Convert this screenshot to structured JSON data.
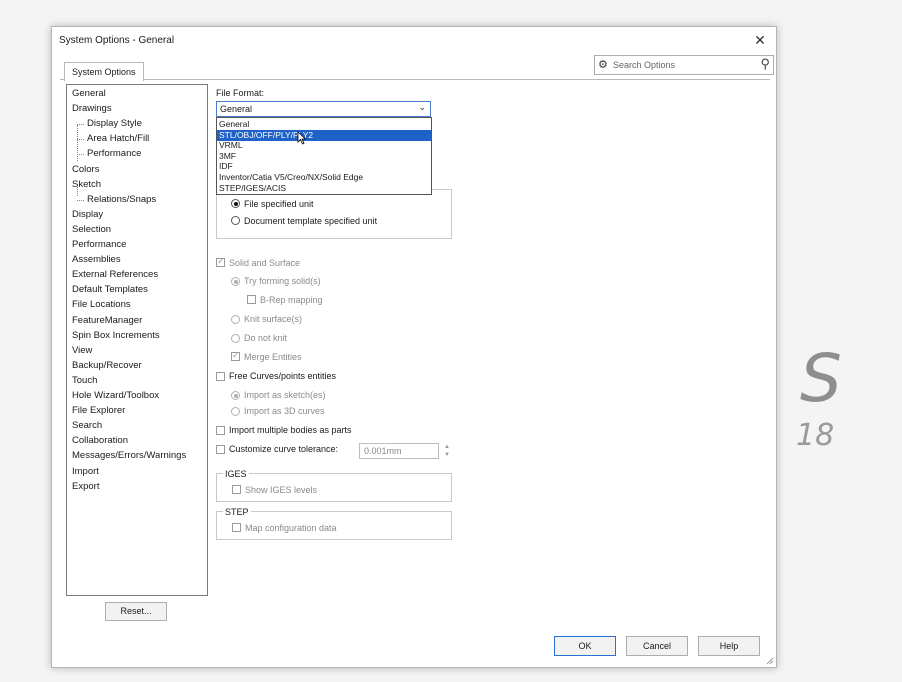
{
  "background": {
    "brand_letter": "S",
    "brand_year": "18"
  },
  "window": {
    "title": "System Options - General",
    "close_glyph": "✕"
  },
  "tab": {
    "label": "System Options"
  },
  "search": {
    "placeholder": "Search Options"
  },
  "tree": {
    "items": [
      {
        "label": "General",
        "indent": 0
      },
      {
        "label": "Drawings",
        "indent": 0
      },
      {
        "label": "Display Style",
        "indent": 1
      },
      {
        "label": "Area Hatch/Fill",
        "indent": 1
      },
      {
        "label": "Performance",
        "indent": 1
      },
      {
        "label": "Colors",
        "indent": 0
      },
      {
        "label": "Sketch",
        "indent": 0
      },
      {
        "label": "Relations/Snaps",
        "indent": 1
      },
      {
        "label": "Display",
        "indent": 0
      },
      {
        "label": "Selection",
        "indent": 0
      },
      {
        "label": "Performance",
        "indent": 0
      },
      {
        "label": "Assemblies",
        "indent": 0
      },
      {
        "label": "External References",
        "indent": 0
      },
      {
        "label": "Default Templates",
        "indent": 0
      },
      {
        "label": "File Locations",
        "indent": 0
      },
      {
        "label": "FeatureManager",
        "indent": 0
      },
      {
        "label": "Spin Box Increments",
        "indent": 0
      },
      {
        "label": "View",
        "indent": 0
      },
      {
        "label": "Backup/Recover",
        "indent": 0
      },
      {
        "label": "Touch",
        "indent": 0
      },
      {
        "label": "Hole Wizard/Toolbox",
        "indent": 0
      },
      {
        "label": "File Explorer",
        "indent": 0
      },
      {
        "label": "Search",
        "indent": 0
      },
      {
        "label": "Collaboration",
        "indent": 0
      },
      {
        "label": "Messages/Errors/Warnings",
        "indent": 0
      },
      {
        "label": "Import",
        "indent": 0
      },
      {
        "label": "Export",
        "indent": 0
      }
    ]
  },
  "reset_label": "Reset...",
  "file_format": {
    "label": "File Format:",
    "selected": "General",
    "options": [
      "General",
      "STL/OBJ/OFF/PLY/PLY2",
      "VRML",
      "3MF",
      "IDF",
      "Inventor/Catia V5/Creo/NX/Solid Edge",
      "STEP/IGES/ACIS"
    ],
    "highlighted_index": 1
  },
  "units": {
    "file_specified": "File specified unit",
    "document_template": "Document template specified unit"
  },
  "options": {
    "solid_and_surface": "Solid and Surface",
    "try_forming_solids": "Try forming solid(s)",
    "brep_mapping": "B-Rep mapping",
    "knit_surfaces": "Knit surface(s)",
    "do_not_knit": "Do not knit",
    "merge_entities": "Merge Entities",
    "free_curves": "Free Curves/points entities",
    "import_as_sketch": "Import as sketch(es)",
    "import_as_3d_curves": "Import as 3D curves",
    "import_multiple_bodies": "Import multiple bodies as parts",
    "customize_curve_tolerance": "Customize curve tolerance:",
    "tolerance_value": "0.001mm"
  },
  "iges": {
    "title": "IGES",
    "show_levels": "Show IGES levels"
  },
  "step": {
    "title": "STEP",
    "map_config": "Map configuration data"
  },
  "buttons": {
    "ok": "OK",
    "cancel": "Cancel",
    "help": "Help"
  }
}
